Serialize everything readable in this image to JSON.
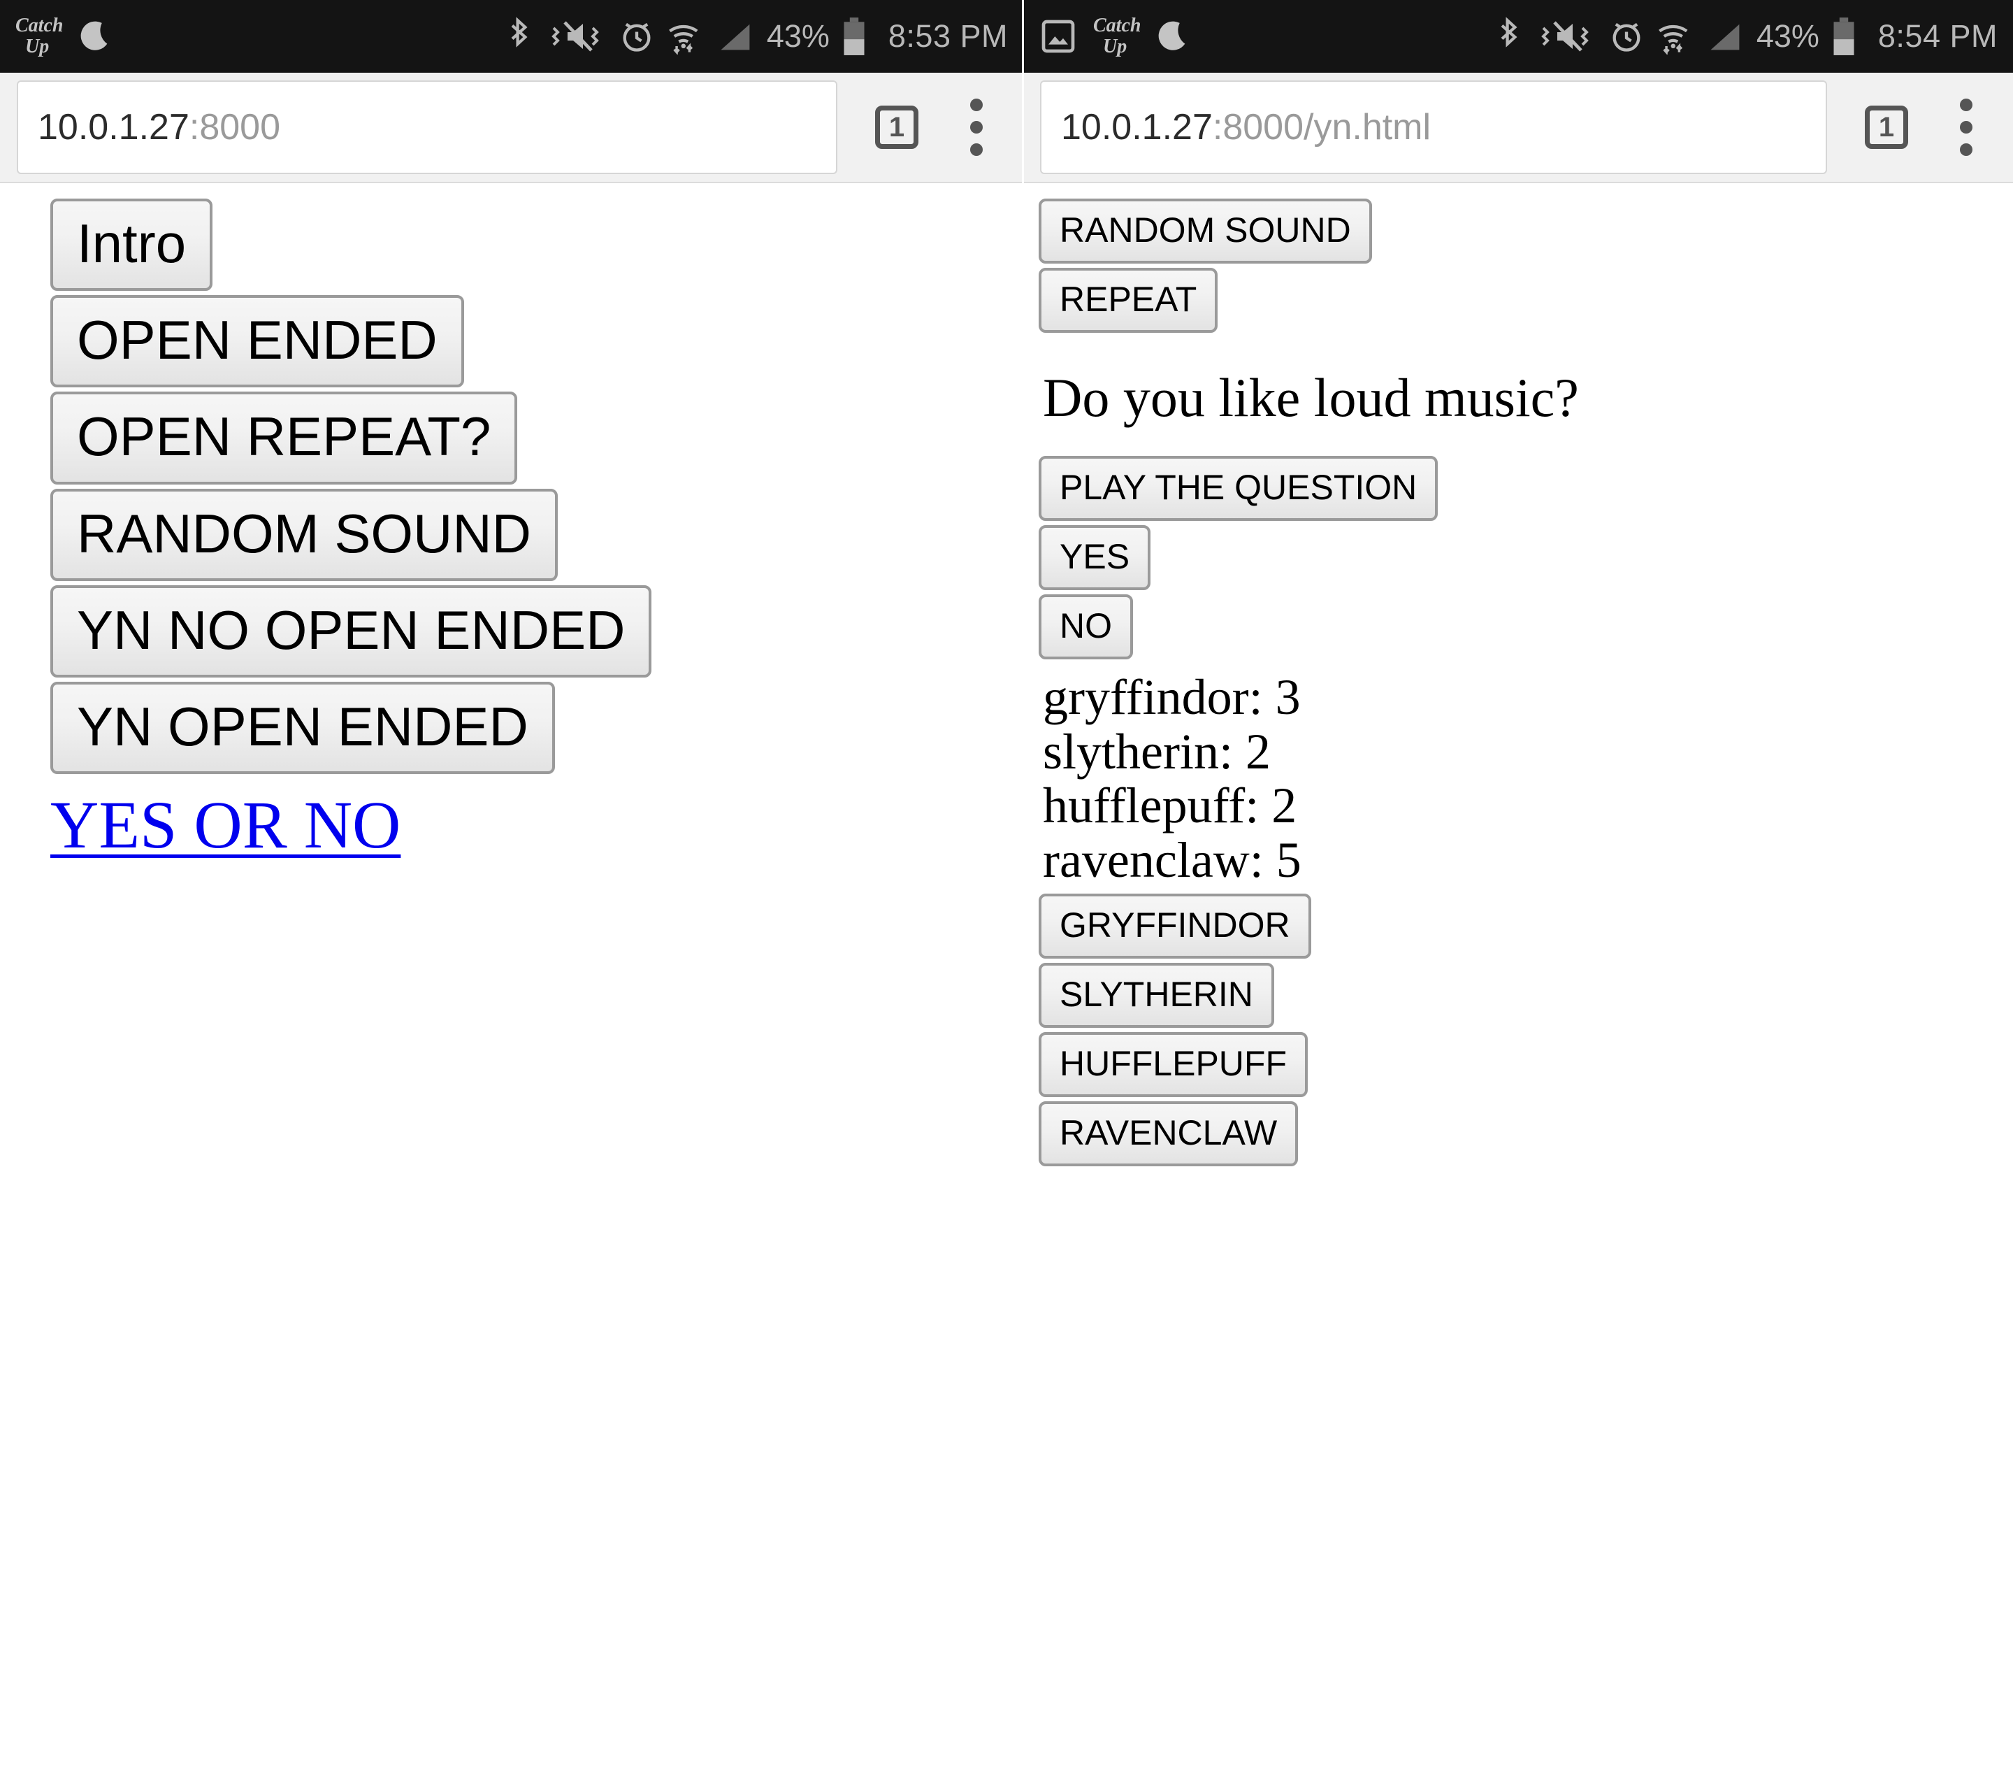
{
  "device": {
    "status_bar_left": {
      "app_logo": {
        "line1": "Catch",
        "line2": "Up",
        "name": "catch-up-logo"
      },
      "icons": [
        "moon-icon"
      ]
    },
    "status_bar_right_icons": [
      "bluetooth-icon",
      "vibrate-mute-icon",
      "alarm-icon",
      "wifi-icon",
      "signal-icon"
    ],
    "battery_percent": "43%",
    "colors": {
      "status_bar_bg": "#141414",
      "status_bar_fg": "#b8b8b8",
      "toolbar_bg": "#f1f1f1",
      "link": "#0000ee",
      "button_border": "#9a9a9a"
    }
  },
  "left_window": {
    "status_bar": {
      "battery_percent": "43%",
      "time": "8:53 PM"
    },
    "toolbar": {
      "url_host": "10.0.1.27",
      "url_rest": ":8000",
      "tab_count": "1",
      "tab_count_name": "tab-counter",
      "menu_name": "overflow-menu-icon"
    },
    "buttons": [
      {
        "label": "Intro",
        "name": "intro-button"
      },
      {
        "label": "OPEN ENDED",
        "name": "open-ended-button"
      },
      {
        "label": "OPEN REPEAT?",
        "name": "open-repeat-button"
      },
      {
        "label": "RANDOM SOUND",
        "name": "random-sound-button"
      },
      {
        "label": "YN NO OPEN ENDED",
        "name": "yn-no-open-ended-button"
      },
      {
        "label": "YN OPEN ENDED",
        "name": "yn-open-ended-button"
      }
    ],
    "link": {
      "label": "YES OR NO",
      "name": "yes-or-no-link"
    }
  },
  "right_window": {
    "status_bar": {
      "battery_percent": "43%",
      "time": "8:54 PM"
    },
    "toolbar": {
      "url_host": "10.0.1.27",
      "url_rest": ":8000/yn.html",
      "tab_count": "1"
    },
    "top_buttons": [
      {
        "label": "RANDOM SOUND",
        "name": "random-sound-button"
      },
      {
        "label": "REPEAT",
        "name": "repeat-button"
      }
    ],
    "question": "Do you like loud music?",
    "answer_buttons": [
      {
        "label": "PLAY THE QUESTION",
        "name": "play-the-question-button"
      },
      {
        "label": "YES",
        "name": "yes-button"
      },
      {
        "label": "NO",
        "name": "no-button"
      }
    ],
    "tally": [
      {
        "label": "gryffindor",
        "count": 3,
        "text": "gryffindor: 3"
      },
      {
        "label": "slytherin",
        "count": 2,
        "text": "slytherin: 2"
      },
      {
        "label": "hufflepuff",
        "count": 2,
        "text": "hufflepuff: 2"
      },
      {
        "label": "ravenclaw",
        "count": 5,
        "text": "ravenclaw: 5"
      }
    ],
    "house_buttons": [
      {
        "label": "GRYFFINDOR",
        "name": "gryffindor-button"
      },
      {
        "label": "SLYTHERIN",
        "name": "slytherin-button"
      },
      {
        "label": "HUFFLEPUFF",
        "name": "hufflepuff-button"
      },
      {
        "label": "RAVENCLAW",
        "name": "ravenclaw-button"
      }
    ]
  }
}
